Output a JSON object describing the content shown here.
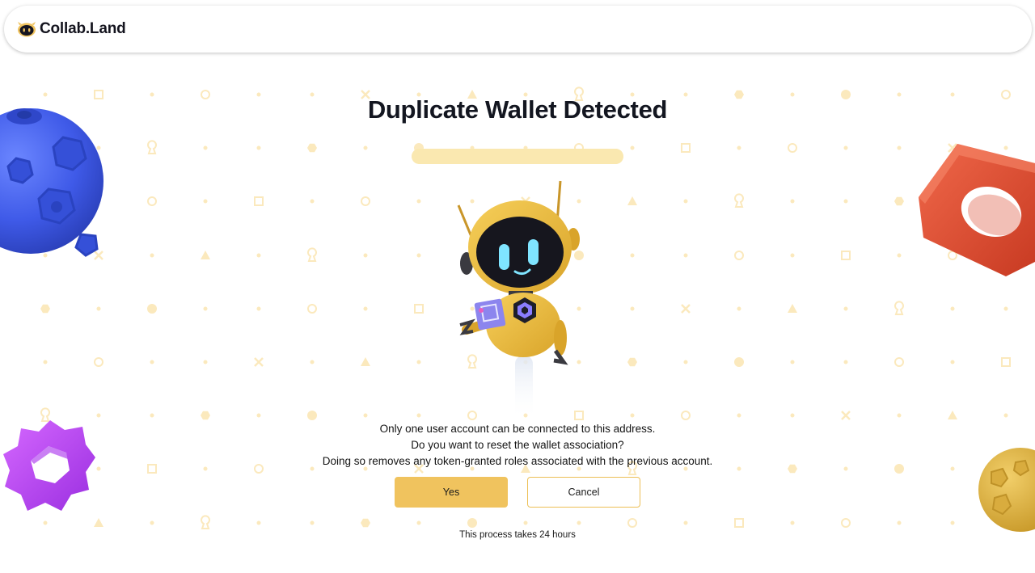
{
  "app": {
    "brand_name": "Collab.Land",
    "logo_icon": "robot-head-icon",
    "accent_color": "#f0c35e",
    "pattern_color": "#fbe9bd"
  },
  "dialog": {
    "title": "Duplicate Wallet Detected",
    "progress_fraction": 1.0,
    "message_lines": [
      "Only one user account can be connected to this address.",
      "Do you want to reset the wallet association?",
      "Doing so removes any token-granted roles associated with the previous account."
    ],
    "yes_label": "Yes",
    "cancel_label": "Cancel",
    "footnote": "This process takes 24 hours"
  }
}
